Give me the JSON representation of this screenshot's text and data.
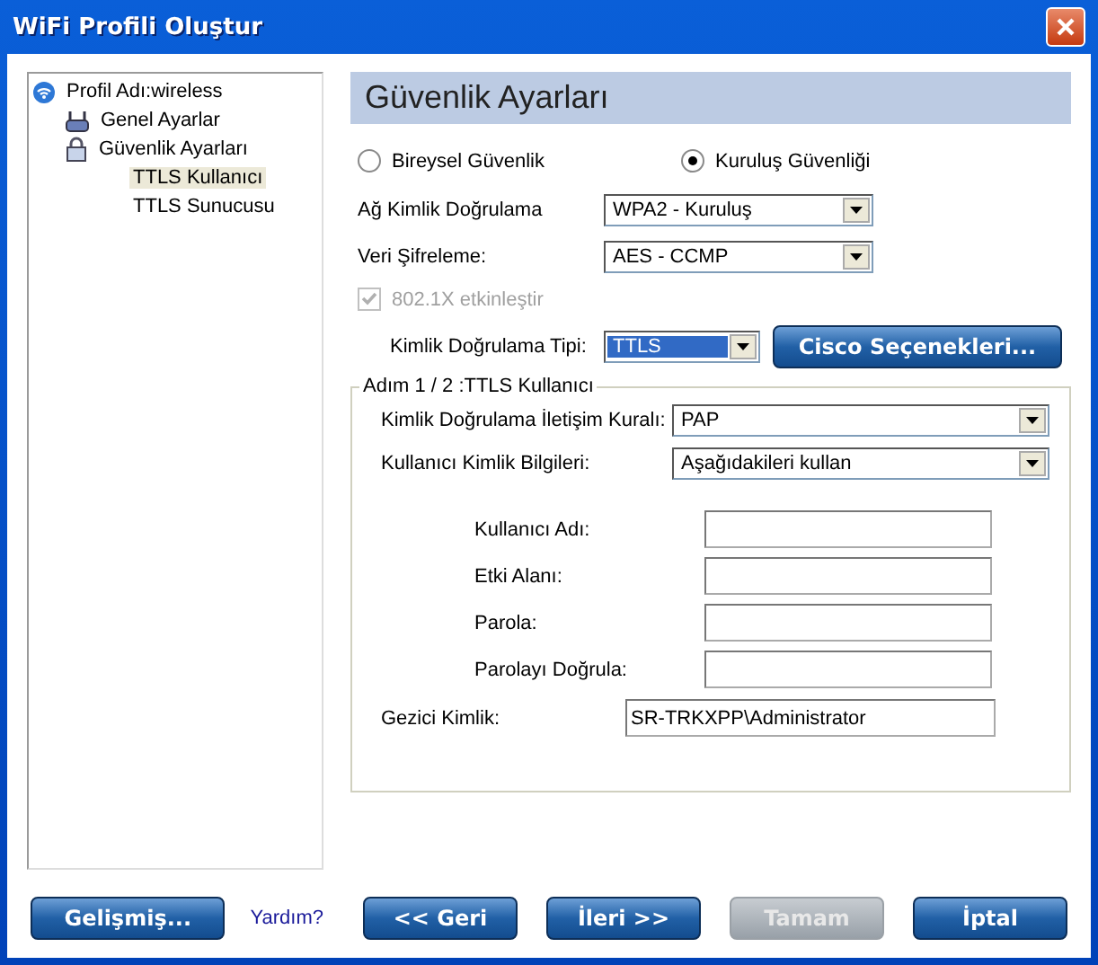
{
  "window": {
    "title": "WiFi Profili Oluştur"
  },
  "tree": [
    {
      "label": "Profil Adı:wireless",
      "kind": "wifi",
      "selected": false,
      "children": [
        {
          "label": "Genel Ayarlar",
          "kind": "router",
          "selected": false
        },
        {
          "label": "Güvenlik Ayarları",
          "kind": "lock",
          "selected": false,
          "children": [
            {
              "label": "TTLS Kullanıcı",
              "kind": "plain",
              "selected": true
            },
            {
              "label": "TTLS Sunucusu",
              "kind": "plain",
              "selected": false
            }
          ]
        }
      ]
    }
  ],
  "heading": "Güvenlik Ayarları",
  "security_mode": [
    {
      "label": "Bireysel Güvenlik",
      "selected": false
    },
    {
      "label": "Kuruluş Güvenliği",
      "selected": true
    }
  ],
  "auth_fields": [
    {
      "label": "Ağ Kimlik Doğrulama",
      "value": "WPA2 - Kuruluş"
    },
    {
      "label": "Veri Şifreleme:",
      "value": "AES - CCMP"
    }
  ],
  "enable_8021x": {
    "label": "802.1X etkinleştir",
    "checked": true,
    "disabled": true
  },
  "auth_type": {
    "label": "Kimlik Doğrulama Tipi:",
    "value": "TTLS",
    "focused": true
  },
  "cisco_button": "Cisco Seçenekleri...",
  "step_group": {
    "title": "Adım 1 / 2 :TTLS Kullanıcı",
    "dropdowns": [
      {
        "label": "Kimlik Doğrulama İletişim Kuralı:",
        "value": "PAP"
      },
      {
        "label": "Kullanıcı Kimlik Bilgileri:",
        "value": "Aşağıdakileri kullan"
      }
    ],
    "inputs": [
      {
        "label": "Kullanıcı Adı:"
      },
      {
        "label": "Etki Alanı:"
      },
      {
        "label": "Parola:"
      },
      {
        "label": "Parolayı Doğrula:"
      }
    ],
    "roaming": {
      "label": "Gezici Kimlik:",
      "value": "SR-TRKXPP\\Administrator"
    }
  },
  "buttons_left": [
    {
      "label": "Gelişmiş...",
      "disabled": false
    }
  ],
  "help_link": "Yardım?",
  "buttons_right": [
    {
      "label": "<< Geri",
      "disabled": false
    },
    {
      "label": "İleri >>",
      "disabled": false
    },
    {
      "label": "Tamam",
      "disabled": true
    },
    {
      "label": "İptal",
      "disabled": false
    }
  ]
}
